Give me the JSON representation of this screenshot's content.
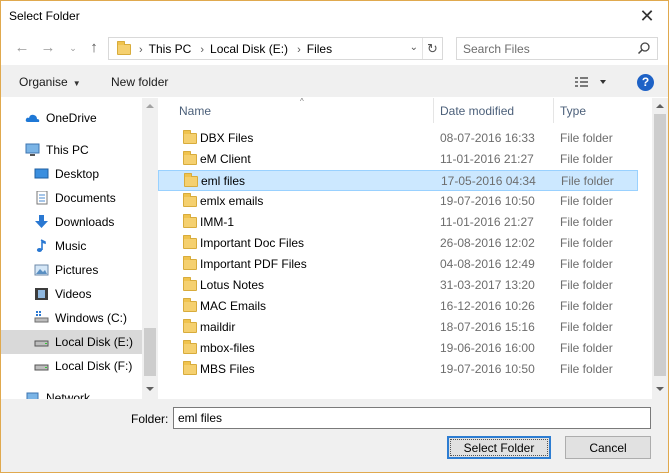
{
  "window": {
    "title": "Select Folder"
  },
  "address": {
    "crumbs": [
      "This PC",
      "Local Disk (E:)",
      "Files"
    ]
  },
  "search": {
    "placeholder": "Search Files"
  },
  "toolbar": {
    "organise": "Organise",
    "new_folder": "New folder",
    "help": "?"
  },
  "nav": {
    "items": [
      {
        "label": "OneDrive",
        "icon": "cloud-icon"
      },
      {
        "label": "This PC",
        "icon": "computer-icon"
      },
      {
        "label": "Desktop",
        "icon": "desktop-icon"
      },
      {
        "label": "Documents",
        "icon": "documents-icon"
      },
      {
        "label": "Downloads",
        "icon": "downloads-icon"
      },
      {
        "label": "Music",
        "icon": "music-icon"
      },
      {
        "label": "Pictures",
        "icon": "pictures-icon"
      },
      {
        "label": "Videos",
        "icon": "videos-icon"
      },
      {
        "label": "Windows (C:)",
        "icon": "drive-icon"
      },
      {
        "label": "Local Disk (E:)",
        "icon": "drive-icon"
      },
      {
        "label": "Local Disk (F:)",
        "icon": "drive-icon"
      },
      {
        "label": "Network",
        "icon": "network-icon"
      }
    ]
  },
  "list": {
    "columns": {
      "name": "Name",
      "date": "Date modified",
      "type": "Type"
    },
    "rows": [
      {
        "name": "DBX Files",
        "date": "08-07-2016 16:33",
        "type": "File folder"
      },
      {
        "name": "eM Client",
        "date": "11-01-2016 21:27",
        "type": "File folder"
      },
      {
        "name": "eml files",
        "date": "17-05-2016 04:34",
        "type": "File folder"
      },
      {
        "name": "emlx emails",
        "date": "19-07-2016 10:50",
        "type": "File folder"
      },
      {
        "name": "IMM-1",
        "date": "11-01-2016 21:27",
        "type": "File folder"
      },
      {
        "name": "Important Doc Files",
        "date": "26-08-2016 12:02",
        "type": "File folder"
      },
      {
        "name": "Important PDF Files",
        "date": "04-08-2016 12:49",
        "type": "File folder"
      },
      {
        "name": "Lotus Notes",
        "date": "31-03-2017 13:20",
        "type": "File folder"
      },
      {
        "name": "MAC Emails",
        "date": "16-12-2016 10:26",
        "type": "File folder"
      },
      {
        "name": "maildir",
        "date": "18-07-2016 15:16",
        "type": "File folder"
      },
      {
        "name": "mbox-files",
        "date": "19-06-2016 16:00",
        "type": "File folder"
      },
      {
        "name": "MBS Files",
        "date": "19-07-2016 10:50",
        "type": "File folder"
      }
    ]
  },
  "bottom": {
    "folder_label": "Folder:",
    "folder_value": "eml files",
    "select_label": "Select Folder",
    "cancel_label": "Cancel"
  }
}
